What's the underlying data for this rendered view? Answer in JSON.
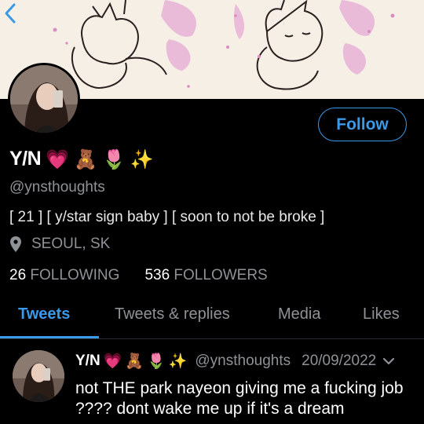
{
  "header": {
    "back_icon": "chevron-left-icon"
  },
  "profile": {
    "display_name": "Y/N",
    "name_emojis": [
      "💗",
      "🧸",
      "🌷",
      "✨"
    ],
    "handle": "@ynsthoughts",
    "bio": "[ 21 ] [ y/star sign baby ] [ soon to not be broke ]",
    "location": "SEOUL, SK",
    "following_count": "26",
    "following_label": "FOLLOWING",
    "followers_count": "536",
    "followers_label": "FOLLOWERS",
    "follow_label": "Follow"
  },
  "tabs": [
    {
      "label": "Tweets",
      "active": true
    },
    {
      "label": "Tweets & replies",
      "active": false
    },
    {
      "label": "Media",
      "active": false
    },
    {
      "label": "Likes",
      "active": false
    }
  ],
  "tweet": {
    "name": "Y/N",
    "name_emojis": [
      "💗",
      "🧸",
      "🌷",
      "✨"
    ],
    "handle": "@ynsthoughts",
    "date": "20/09/2022",
    "text": "not THE park nayeon giving me a fucking job ???? dont wake me up if it's a dream"
  },
  "colors": {
    "accent": "#3b9ae8",
    "muted": "#8e9296",
    "background": "#000000",
    "banner": "#f6efe6"
  }
}
